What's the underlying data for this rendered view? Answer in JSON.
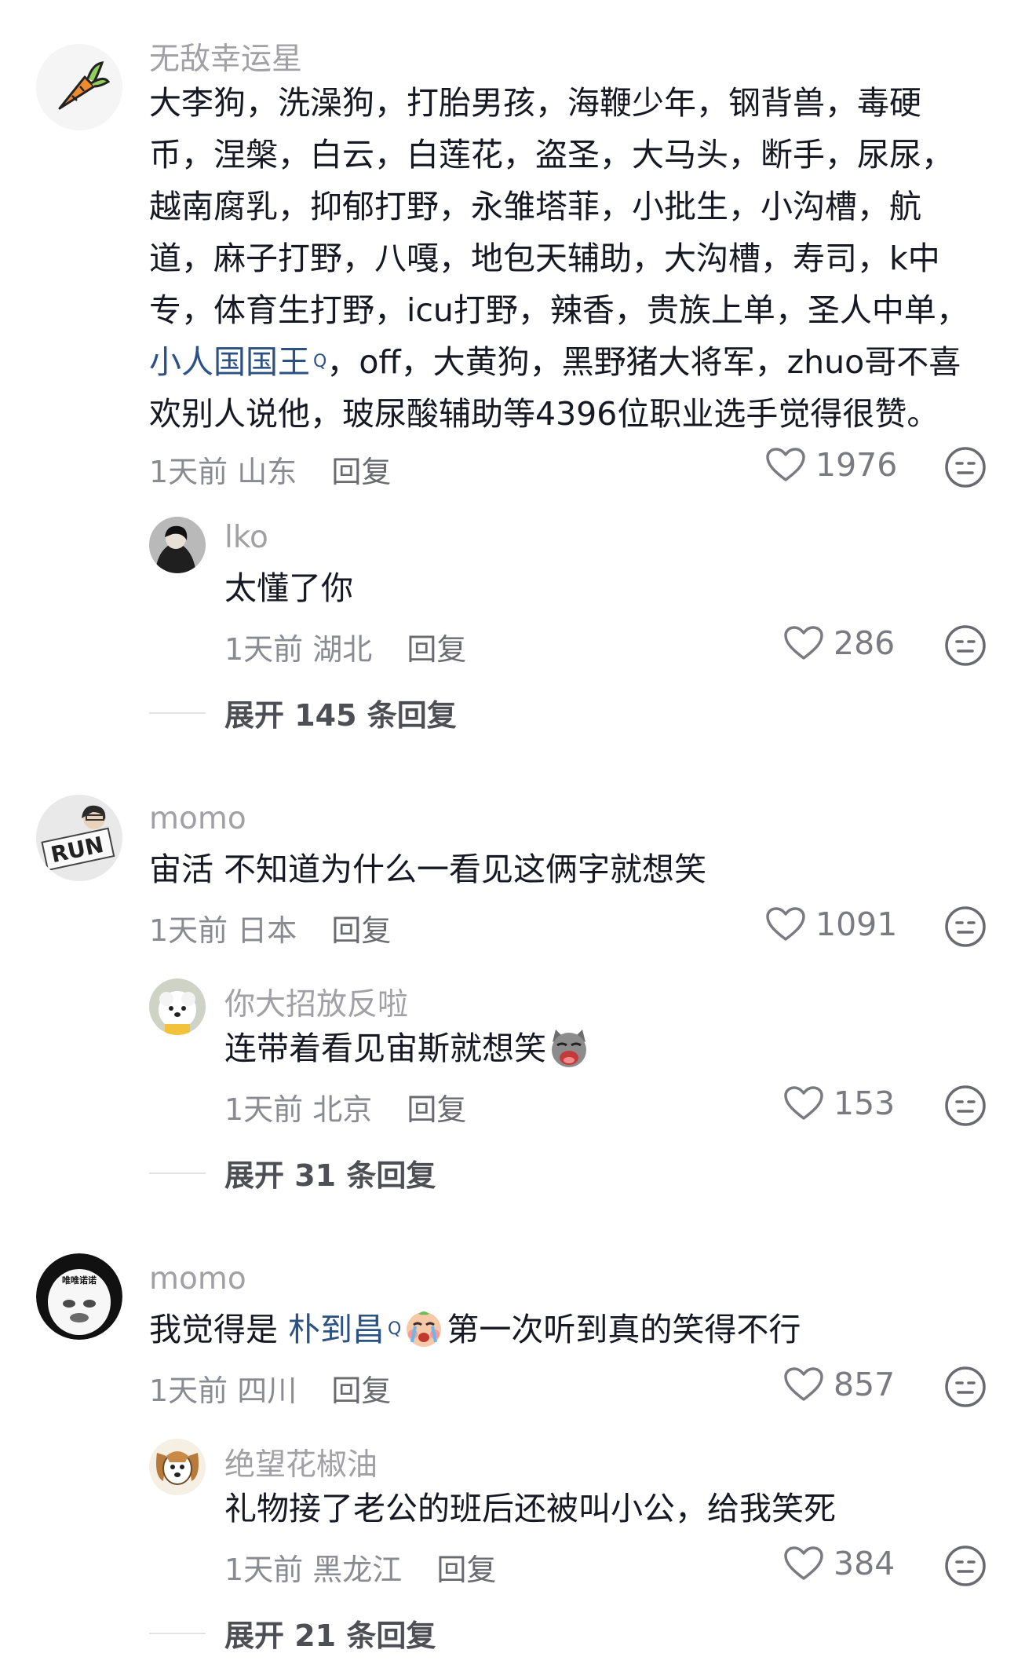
{
  "comments": [
    {
      "username": "无敌幸运星",
      "avatar_icon": "carrot-avatar",
      "lines": [
        "大李狗，洗澡狗，打胎男孩，海鞭少年，钢背兽，毒硬",
        "币，涅槃，白云，白莲花，盗圣，大马头，断手，尿尿，",
        "越南腐乳，抑郁打野，永雏塔菲，小批生，小沟槽，航",
        "道，麻子打野，八嘎，地包天辅助，大沟槽，寿司，k中",
        "专，体育生打野，icu打野，辣香，贵族上单，圣人中单，"
      ],
      "link_text": "小人国国王",
      "link_sup": "Q",
      "line6_rest": "，off，大黄狗，黑野猪大将军，zhuo哥不喜",
      "line7": "欢别人说他，玻尿酸辅助等4396位职业选手觉得很赞。",
      "time": "1天前",
      "location": "山东",
      "reply_label": "回复",
      "likes": "1976",
      "reply": {
        "username": "lko",
        "text": "太懂了你",
        "time": "1天前",
        "location": "湖北",
        "reply_label": "回复",
        "likes": "286"
      },
      "expand_label": "展开 145 条回复"
    },
    {
      "username": "momo",
      "avatar_icon": "run-avatar",
      "text": "宙活 不知道为什么一看见这俩字就想笑",
      "time": "1天前",
      "location": "日本",
      "reply_label": "回复",
      "likes": "1091",
      "reply": {
        "username": "你大招放反啦",
        "text": "连带着看见宙斯就想笑",
        "emoji_icon": "laughing-cat-emoji",
        "time": "1天前",
        "location": "北京",
        "reply_label": "回复",
        "likes": "153"
      },
      "expand_label": "展开 31 条回复"
    },
    {
      "username": "momo",
      "avatar_icon": "meme-face-avatar",
      "avatar_text": "唯唯诺诺",
      "text_before": "我觉得是 ",
      "link_text": "朴到昌",
      "link_sup": "Q",
      "emoji_icon": "crying-face-emoji",
      "text_after": "第一次听到真的笑得不行",
      "time": "1天前",
      "location": "四川",
      "reply_label": "回复",
      "likes": "857",
      "reply": {
        "username": "绝望花椒油",
        "text": "礼物接了老公的班后还被叫小公，给我笑死",
        "time": "1天前",
        "location": "黑龙江",
        "reply_label": "回复",
        "likes": "384"
      },
      "expand_label": "展开 21 条回复"
    }
  ],
  "icons": {
    "like": "heart-outline-icon",
    "dislike": "neutral-face-icon"
  }
}
